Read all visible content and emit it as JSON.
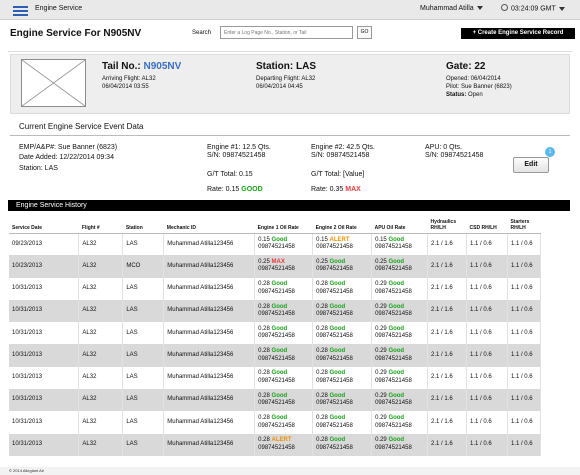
{
  "topbar": {
    "brand": "Engine Service",
    "user": "Muhammad Atilla",
    "time": "03:24:09 GMT"
  },
  "page": {
    "title": "Engine Service For N905NV",
    "search_label": "Search",
    "search_placeholder": "Enter a Log Page No., Station, or Tail",
    "go_label": "GO",
    "create_label": "+ Create Engine Service Record"
  },
  "tail": {
    "label": "Tail No.:",
    "value": "N905NV",
    "arriving": "Arriving Flight: AL32",
    "arriving_time": "06/04/2014   03:55",
    "station_label": "Station: LAS",
    "departing": "Departing Flight: AL32",
    "departing_time": "06/04/2014   04:45",
    "gate_label": "Gate: 22",
    "opened": "Opened: 06/04/2014",
    "pilot": "Pilot: Sue Banner (6823)",
    "status_label": "Status:",
    "status_value": "Open"
  },
  "event": {
    "title": "Current Engine Service Event Data",
    "emp": "EMP/A&P#: Sue Banner (6823)",
    "date_added": "Date Added: 12/22/2014  09:34",
    "station": "Station: LAS",
    "eng1": "Engine #1: 12.5 Qts.",
    "eng1_sn": "S/N: 09874521458",
    "eng1_gt": "G/T Total: 0.15",
    "eng1_rate": "Rate: 0.15",
    "eng1_status": "GOOD",
    "eng2": "Engine #2: 42.5 Qts.",
    "eng2_sn": "S/N: 09874521458",
    "eng2_gt": "G/T Total: [Value]",
    "eng2_rate": "Rate: 0.35",
    "eng2_status": "MAX",
    "apu": "APU: 0 Qts.",
    "apu_sn": "S/N: 09874521458",
    "edit_label": "Edit",
    "badge": "1"
  },
  "history": {
    "title": "Engine Service History",
    "headers": [
      "Service Date",
      "Flight #",
      "Station",
      "Mechanic ID",
      "Engine 1 Oil Rate",
      "Engine 2 Oil Rate",
      "APU Oil Rate",
      "Hydraulics RH/LH",
      "CSD RH/LH",
      "Starters RH/LH"
    ],
    "rows": [
      {
        "date": "09/23/2013",
        "flight": "AL32",
        "station": "LAS",
        "mech": "Muhammad Atilla123456",
        "e1": "0.15",
        "e1s": "Good",
        "e1c": "good",
        "e2": "0.15",
        "e2s": "ALERT",
        "e2c": "alert",
        "apu": "0.15",
        "apus": "Good",
        "apuc": "good",
        "sn": "09874521458",
        "hyd": "2.1 / 1.6",
        "csd": "1.1 / 0.6",
        "start": "1.1 / 0.6"
      },
      {
        "date": "10/23/2013",
        "flight": "AL32",
        "station": "MCO",
        "mech": "Muhammad Atilla123456",
        "e1": "0.25",
        "e1s": "MAX",
        "e1c": "max",
        "e2": "0.25",
        "e2s": "Good",
        "e2c": "good",
        "apu": "0.25",
        "apus": "Good",
        "apuc": "good",
        "sn": "09874521458",
        "hyd": "2.1 / 1.6",
        "csd": "1.1 / 0.6",
        "start": "1.1 / 0.6"
      },
      {
        "date": "10/31/2013",
        "flight": "AL32",
        "station": "LAS",
        "mech": "Muhammad Atilla123456",
        "e1": "0.28",
        "e1s": "Good",
        "e1c": "good",
        "e2": "0.28",
        "e2s": "Good",
        "e2c": "good",
        "apu": "0.29",
        "apus": "Good",
        "apuc": "good",
        "sn": "09874521458",
        "hyd": "2.1 / 1.6",
        "csd": "1.1 / 0.6",
        "start": "1.1 / 0.6"
      },
      {
        "date": "10/31/2013",
        "flight": "AL32",
        "station": "LAS",
        "mech": "Muhammad Atilla123456",
        "e1": "0.28",
        "e1s": "Good",
        "e1c": "good",
        "e2": "0.28",
        "e2s": "Good",
        "e2c": "good",
        "apu": "0.29",
        "apus": "Good",
        "apuc": "good",
        "sn": "09874521458",
        "hyd": "2.1 / 1.6",
        "csd": "1.1 / 0.6",
        "start": "1.1 / 0.6"
      },
      {
        "date": "10/31/2013",
        "flight": "AL32",
        "station": "LAS",
        "mech": "Muhammad Atilla123456",
        "e1": "0.28",
        "e1s": "Good",
        "e1c": "good",
        "e2": "0.28",
        "e2s": "Good",
        "e2c": "good",
        "apu": "0.29",
        "apus": "Good",
        "apuc": "good",
        "sn": "09874521458",
        "hyd": "2.1 / 1.6",
        "csd": "1.1 / 0.6",
        "start": "1.1 / 0.6"
      },
      {
        "date": "10/31/2013",
        "flight": "AL32",
        "station": "LAS",
        "mech": "Muhammad Atilla123456",
        "e1": "0.28",
        "e1s": "Good",
        "e1c": "good",
        "e2": "0.28",
        "e2s": "Good",
        "e2c": "good",
        "apu": "0.29",
        "apus": "Good",
        "apuc": "good",
        "sn": "09874521458",
        "hyd": "2.1 / 1.6",
        "csd": "1.1 / 0.6",
        "start": "1.1 / 0.6"
      },
      {
        "date": "10/31/2013",
        "flight": "AL32",
        "station": "LAS",
        "mech": "Muhammad Atilla123456",
        "e1": "0.28",
        "e1s": "Good",
        "e1c": "good",
        "e2": "0.28",
        "e2s": "Good",
        "e2c": "good",
        "apu": "0.29",
        "apus": "Good",
        "apuc": "good",
        "sn": "09874521458",
        "hyd": "2.1 / 1.6",
        "csd": "1.1 / 0.6",
        "start": "1.1 / 0.6"
      },
      {
        "date": "10/31/2013",
        "flight": "AL32",
        "station": "LAS",
        "mech": "Muhammad Atilla123456",
        "e1": "0.28",
        "e1s": "Good",
        "e1c": "good",
        "e2": "0.28",
        "e2s": "Good",
        "e2c": "good",
        "apu": "0.29",
        "apus": "Good",
        "apuc": "good",
        "sn": "09874521458",
        "hyd": "2.1 / 1.6",
        "csd": "1.1 / 0.6",
        "start": "1.1 / 0.6"
      },
      {
        "date": "10/31/2013",
        "flight": "AL32",
        "station": "LAS",
        "mech": "Muhammad Atilla123456",
        "e1": "0.28",
        "e1s": "Good",
        "e1c": "good",
        "e2": "0.28",
        "e2s": "Good",
        "e2c": "good",
        "apu": "0.29",
        "apus": "Good",
        "apuc": "good",
        "sn": "09874521458",
        "hyd": "2.1 / 1.6",
        "csd": "1.1 / 0.6",
        "start": "1.1 / 0.6"
      },
      {
        "date": "10/31/2013",
        "flight": "AL32",
        "station": "LAS",
        "mech": "Muhammad Atilla123456",
        "e1": "0.28",
        "e1s": "ALERT",
        "e1c": "alert",
        "e2": "0.28",
        "e2s": "Good",
        "e2c": "good",
        "apu": "0.29",
        "apus": "Good",
        "apuc": "good",
        "sn": "09874521458",
        "hyd": "2.1 / 1.6",
        "csd": "1.1 / 0.6",
        "start": "1.1 / 0.6"
      }
    ]
  },
  "footer": {
    "text": "© 2014 Allegiant Air"
  }
}
